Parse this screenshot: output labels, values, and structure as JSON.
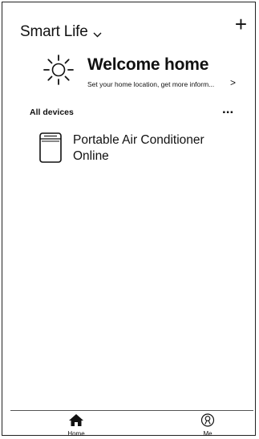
{
  "header": {
    "app_title": "Smart Life",
    "dropdown_icon": "chevron-down-icon",
    "add_icon": "plus-icon",
    "add_label": "+"
  },
  "welcome": {
    "icon": "sun-icon",
    "title": "Welcome home",
    "subtitle": "Set your home location, get more inform...",
    "arrow": ">"
  },
  "devices": {
    "section_label": "All devices",
    "more_label": "...",
    "items": [
      {
        "icon": "portable-air-conditioner-icon",
        "name": "Portable Air Conditioner",
        "status": "Online"
      }
    ]
  },
  "tabbar": {
    "tabs": [
      {
        "icon": "home-icon",
        "label": "Home"
      },
      {
        "icon": "profile-icon",
        "label": "Me"
      }
    ]
  }
}
